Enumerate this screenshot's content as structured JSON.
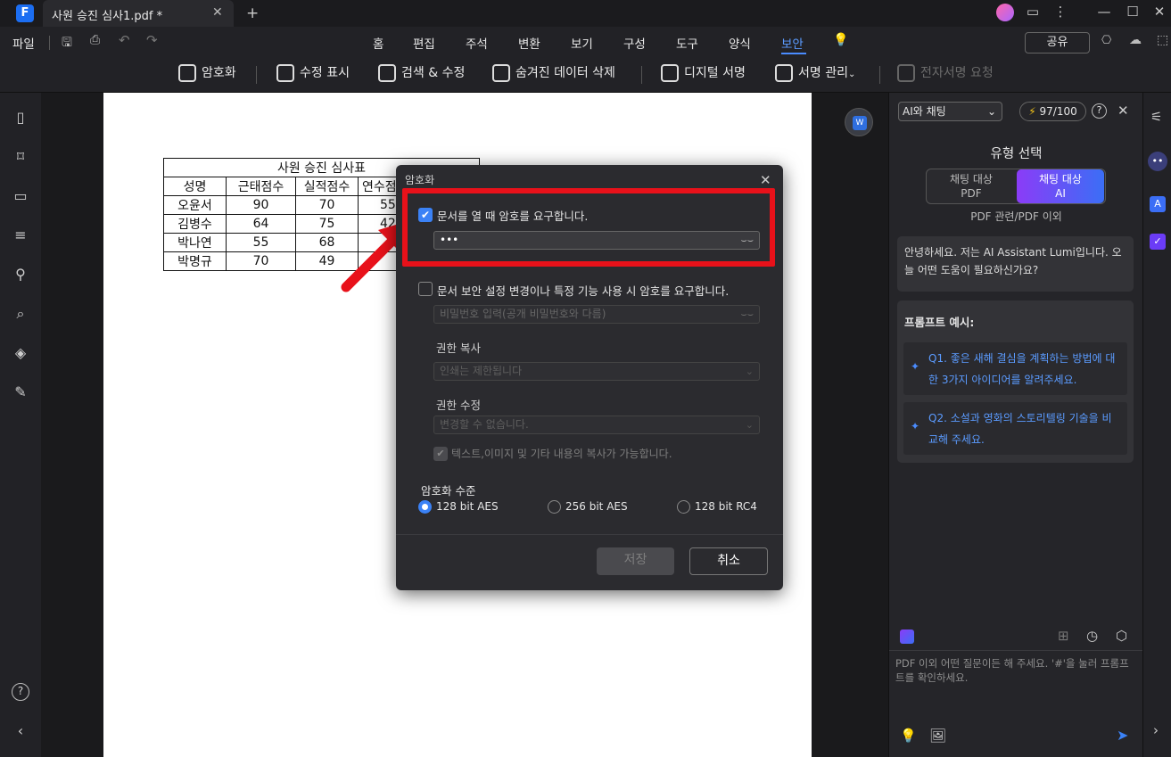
{
  "titlebar": {
    "doc_title": "사원 승진 심사1.pdf *",
    "close_tab": "✕",
    "new_tab": "+"
  },
  "menu": {
    "file": "파일",
    "items": [
      "홈",
      "편집",
      "주석",
      "변환",
      "보기",
      "구성",
      "도구",
      "양식",
      "보안"
    ],
    "active": "보안",
    "share": "공유"
  },
  "toolbar": {
    "encrypt": "암호화",
    "redact_mark": "수정 표시",
    "search_redact": "검색 & 수정",
    "remove_hidden": "숨겨진 데이터 삭제",
    "digital_sign": "디지털 서명",
    "manage_sign": "서명 관리",
    "request_esign": "전자서명 요청"
  },
  "sheet": {
    "title": "사원 승진 심사표",
    "headers": [
      "성명",
      "근태점수",
      "실적점수",
      "연수점"
    ],
    "rows": [
      [
        "오윤서",
        "90",
        "70",
        "55"
      ],
      [
        "김병수",
        "64",
        "75",
        "42"
      ],
      [
        "박나연",
        "55",
        "68",
        ""
      ],
      [
        "박명규",
        "70",
        "49",
        ""
      ]
    ]
  },
  "dialog": {
    "title": "암호화",
    "open_pw_label": "문서를 열 때 암호를 요구합니다.",
    "open_pw_value": "•••",
    "perm_pw_label": "문서 보안 설정 변경이나 특정 기능 사용 시 암호를 요구합니다.",
    "perm_pw_placeholder": "비밀번호 입력(공개 비밀번호와 다름)",
    "print_perm_label": "권한 복사",
    "print_perm_value": "인쇄는 제한됩니다",
    "edit_perm_label": "권한 수정",
    "edit_perm_value": "변경할 수 없습니다.",
    "copy_text_label": "텍스트,이미지 및 기타 내용의 복사가 가능합니다.",
    "enc_level_label": "암호화 수준",
    "enc_options": [
      "128 bit AES",
      "256 bit AES",
      "128 bit RC4"
    ],
    "enc_selected": "128 bit AES",
    "save": "저장",
    "cancel": "취소"
  },
  "ai_panel": {
    "mode": "AI와 채팅",
    "credits": "97/100",
    "type_title": "유형 선택",
    "opt_pdf_line1": "채팅 대상",
    "opt_pdf_line2": "PDF",
    "opt_ai_line1": "채팅 대상",
    "opt_ai_line2": "AI",
    "type_caption": "PDF 관련/PDF 이외",
    "greeting": "안녕하세요. 저는 AI Assistant Lumi입니다. 오늘 어떤 도움이 필요하신가요?",
    "prompt_title": "프롬프트 예시:",
    "prompts": [
      "Q1. 좋은 새해 결심을 계획하는 방법에 대한 3가지 아이디어를 알려주세요.",
      "Q2. 소설과 영화의 스토리텔링 기술을 비교해 주세요."
    ],
    "input_placeholder": "PDF 이외 어떤 질문이든 해 주세요. '#'을 눌러 프롬프트를 확인하세요."
  },
  "colors": {
    "accent": "#3b82f6",
    "highlight_red": "#e8111a"
  }
}
